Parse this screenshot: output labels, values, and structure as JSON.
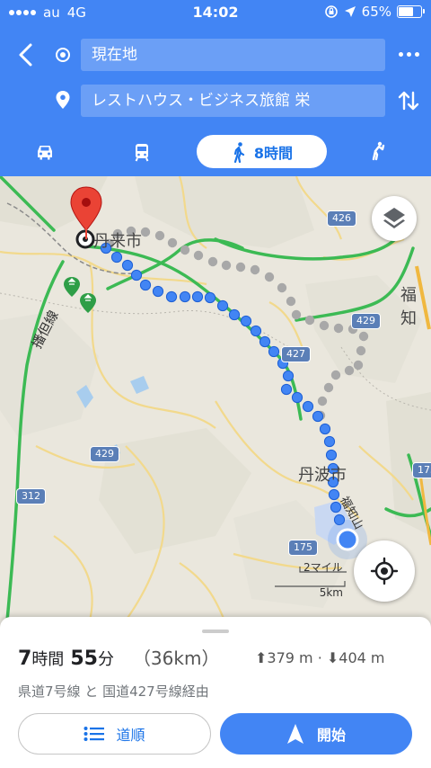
{
  "status_bar": {
    "carrier": "au",
    "network": "4G",
    "time": "14:02",
    "battery": "65%",
    "battery_level": 0.65
  },
  "header": {
    "origin": "現在地",
    "destination": "レストハウス・ビジネス旅館 栄",
    "active_mode_time": "8時間",
    "modes": [
      "car-icon",
      "transit-icon",
      "walking-icon",
      "rideshare-icon"
    ]
  },
  "map": {
    "places": {
      "city_top": "丹来市",
      "city_mid": "丹波市",
      "city_right": "福知"
    },
    "roads": {
      "r426": "426",
      "r429a": "429",
      "r427": "427",
      "r429b": "429",
      "r312": "312",
      "r175a": "175",
      "r175b": "175",
      "sen_label": "播但線"
    },
    "scale": {
      "miles": "2マイル",
      "km": "5km"
    }
  },
  "summary": {
    "hours": "7",
    "hours_unit": "時間",
    "minutes": "55",
    "minutes_unit": "分",
    "distance": "（36km）",
    "ascent": "379 m",
    "descent": "404 m",
    "via": "県道7号線 と 国道427号線経由",
    "steps_label": "道順",
    "start_label": "開始"
  },
  "colors": {
    "brand": "#4285f4",
    "route_blue": "#4285f4",
    "route_gray": "#9e9e9e",
    "pin_red": "#ea4335",
    "highway_green": "#3cba54"
  }
}
